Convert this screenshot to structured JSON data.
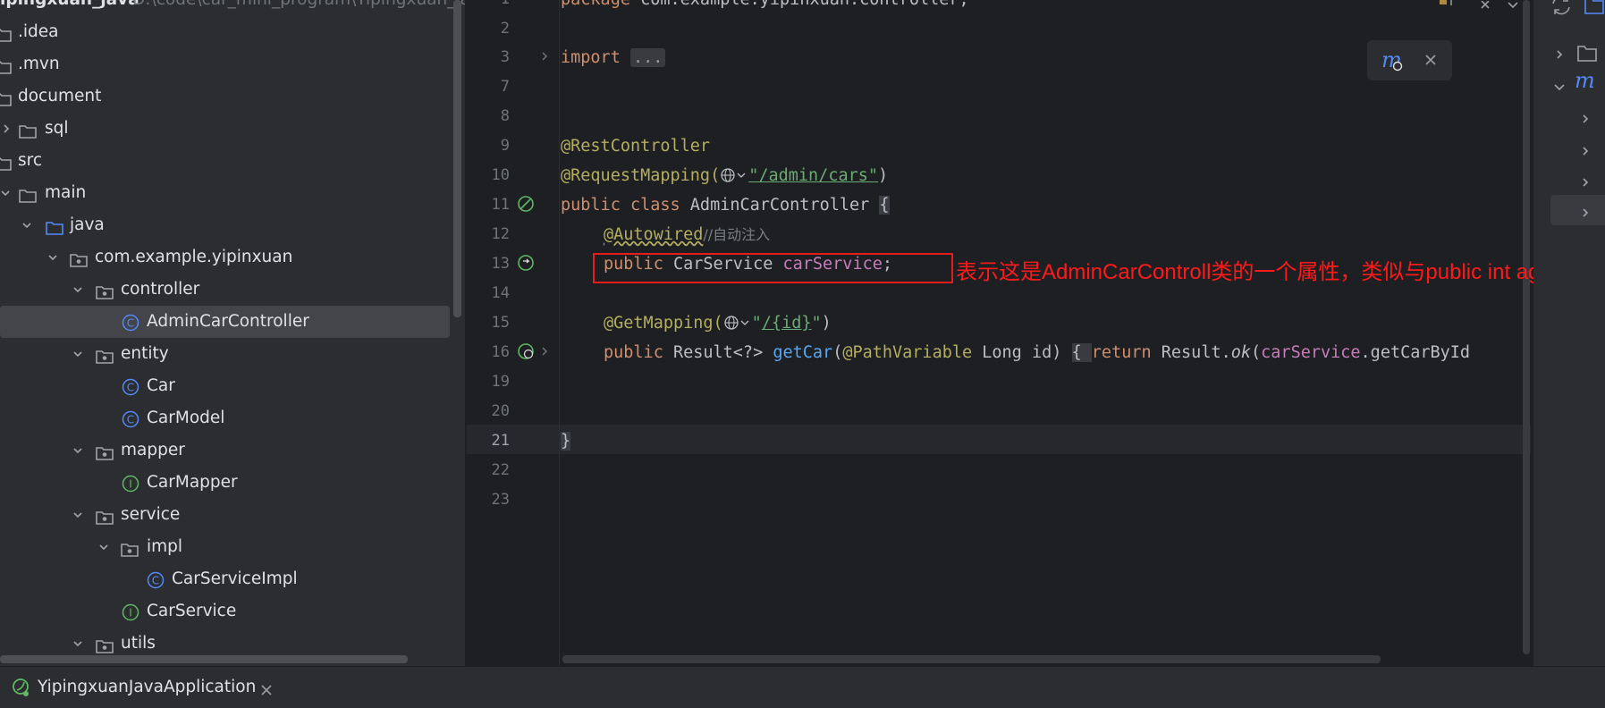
{
  "project": {
    "name": "ipingxuan_java",
    "path": "D:\\code\\car_mini_program\\Yipingxuan_java"
  },
  "tree": {
    "items": [
      {
        "label": ".idea",
        "icon": "folder-icon"
      },
      {
        "label": ".mvn",
        "icon": "folder-icon"
      },
      {
        "label": "document",
        "icon": "folder-icon"
      },
      {
        "label": "sql",
        "icon": "folder-icon"
      },
      {
        "label": "src",
        "icon": "folder-icon"
      },
      {
        "label": "main",
        "icon": "folder-icon"
      },
      {
        "label": "java",
        "icon": "source-folder-icon"
      },
      {
        "label": "com.example.yipinxuan",
        "icon": "package-icon"
      },
      {
        "label": "controller",
        "icon": "package-icon"
      },
      {
        "label": "AdminCarController",
        "icon": "class-icon"
      },
      {
        "label": "entity",
        "icon": "package-icon"
      },
      {
        "label": "Car",
        "icon": "class-icon"
      },
      {
        "label": "CarModel",
        "icon": "class-icon"
      },
      {
        "label": "mapper",
        "icon": "package-icon"
      },
      {
        "label": "CarMapper",
        "icon": "interface-icon"
      },
      {
        "label": "service",
        "icon": "package-icon"
      },
      {
        "label": "impl",
        "icon": "package-icon"
      },
      {
        "label": "CarServiceImpl",
        "icon": "class-icon"
      },
      {
        "label": "CarService",
        "icon": "interface-icon"
      },
      {
        "label": "utils",
        "icon": "package-icon"
      }
    ]
  },
  "editor": {
    "line_numbers": [
      "1",
      "2",
      "3",
      "7",
      "8",
      "9",
      "10",
      "11",
      "12",
      "13",
      "14",
      "15",
      "16",
      "19",
      "20",
      "21",
      "22",
      "23"
    ],
    "current_line": "21",
    "code": {
      "l1_kw": "package",
      "l1_rest": " com.example.yipinxuan.controller;",
      "l3_kw": "import",
      "l3_folded": "...",
      "l9": "@RestController",
      "l10_ann": "@RequestMapping(",
      "l10_str": "\"/admin/cars\"",
      "l10_end": ")",
      "l11_kw": "public class",
      "l11_name": " AdminCarController ",
      "l11_brace": "{",
      "l12_ann": "@Autowired",
      "l12_cmt": "//自动注入",
      "l13_kw": "public",
      "l13_type": " CarService ",
      "l13_field": "carService",
      "l13_end": ";",
      "l15_ann": "@GetMapping(",
      "l15_str_open": "\"",
      "l15_str_path": "/{id}",
      "l15_str_close": "\"",
      "l15_end": ")",
      "l16_kw": "public",
      "l16_type": " Result<?> ",
      "l16_method": "getCar",
      "l16_paren": "(",
      "l16_ann": "@PathVariable",
      "l16_params": " Long id) ",
      "l16_brace": "{ ",
      "l16_return": "return",
      "l16_result": " Result.",
      "l16_ok": "ok",
      "l16_open": "(",
      "l16_field": "carService",
      "l16_call": ".getCarById",
      "l21": "}"
    },
    "annotation_note": "表示这是AdminCarControll类的一个属性，类似与public int age"
  },
  "bottom": {
    "run_tab": "YipingxuanJavaApplication"
  },
  "colors": {
    "keyword": "#cf8e6d",
    "annotation": "#b3ae60",
    "string": "#6aab73",
    "field": "#c77dbb",
    "method": "#56a8f5",
    "note": "#ff1a1a"
  }
}
